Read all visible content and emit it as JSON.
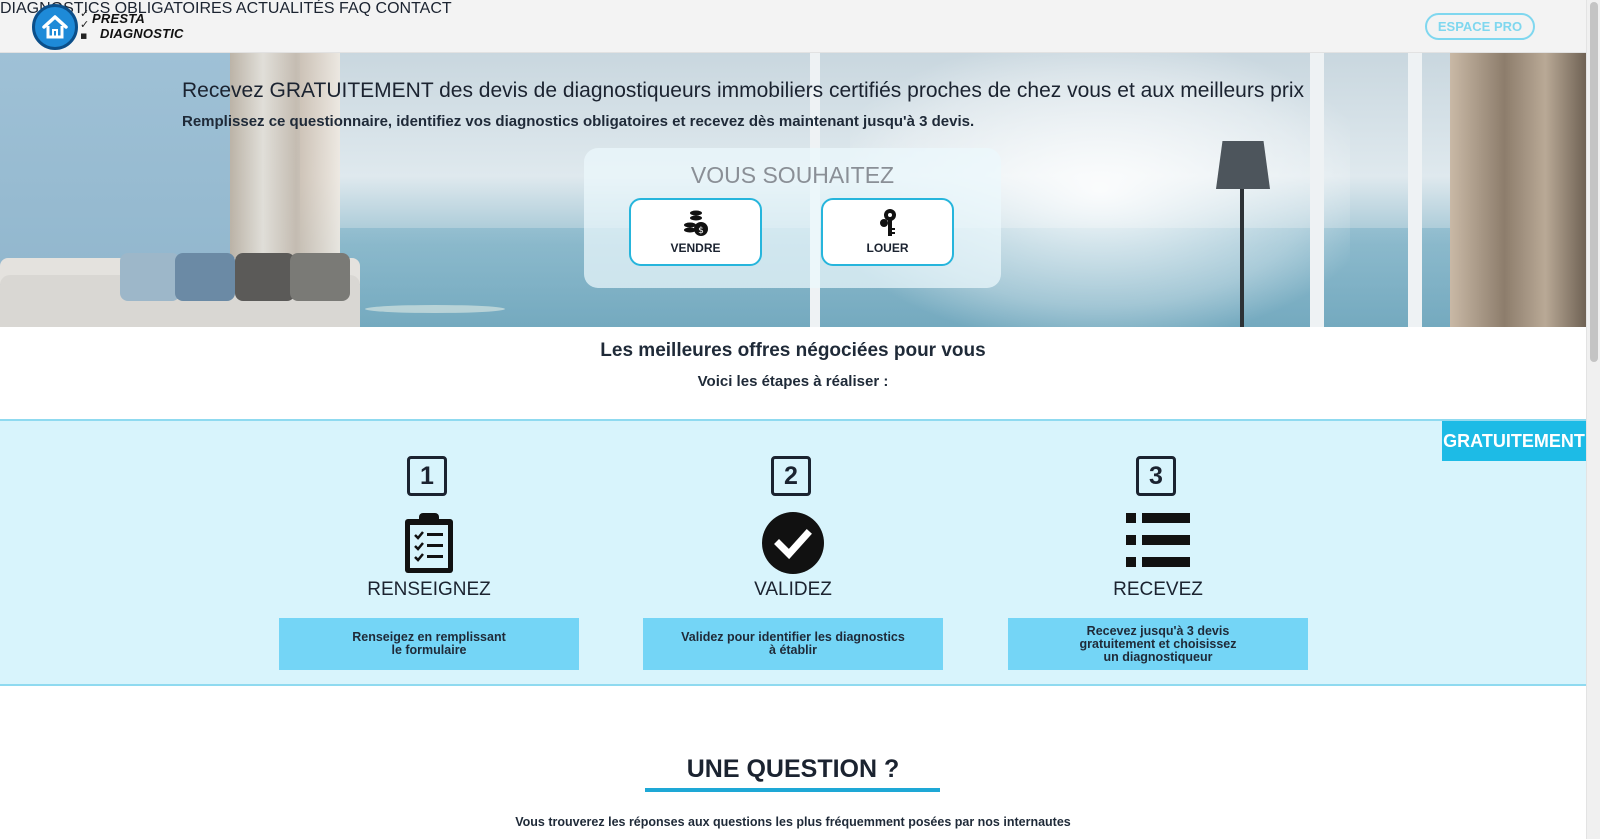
{
  "brand": {
    "line1": "PRESTA",
    "line2": "DIAGNOSTIC",
    "checks": "✓\n✓\n▪"
  },
  "nav": {
    "items": [
      "DIAGNOSTICS OBLIGATOIRES",
      "ACTUALITÉS",
      "FAQ",
      "CONTACT"
    ],
    "cta": "ESPACE PRO"
  },
  "hero": {
    "title": "Recevez GRATUITEMENT des devis de diagnostiqueurs immobiliers certifiés proches de chez vous et aux meilleurs prix",
    "subtitle": "Remplissez ce questionnaire, identifiez vos diagnostics obligatoires et recevez dès maintenant jusqu'à 3 devis.",
    "choice_title": "VOUS SOUHAITEZ",
    "choices": [
      {
        "label": "VENDRE",
        "icon": "coins-icon"
      },
      {
        "label": "LOUER",
        "icon": "keys-icon"
      }
    ]
  },
  "intro": {
    "title": "Les meilleures offres négociées pour vous",
    "subtitle": "Voici les étapes à réaliser :"
  },
  "steps": {
    "badge": "GRATUITEMENT",
    "items": [
      {
        "number": "1",
        "title": "RENSEIGNEZ",
        "icon": "clipboard-icon",
        "text": "Renseigez en remplissant\nle formulaire"
      },
      {
        "number": "2",
        "title": "VALIDEZ",
        "icon": "check-circle-icon",
        "text": "Validez pour identifier les diagnostics\nà établir"
      },
      {
        "number": "3",
        "title": "RECEVEZ",
        "icon": "list-icon",
        "text": "Recevez jusqu'à 3 devis\ngratuitement et choisissez\nun diagnostiqueur"
      }
    ]
  },
  "question": {
    "title": "UNE QUESTION ?",
    "subtitle": "Vous trouverez les réponses aux questions les plus fréquemment posées par nos internautes"
  },
  "colors": {
    "accent": "#1dbbe6",
    "band": "#d8f4fc",
    "box": "#74d5f6",
    "text": "#1b2330"
  }
}
